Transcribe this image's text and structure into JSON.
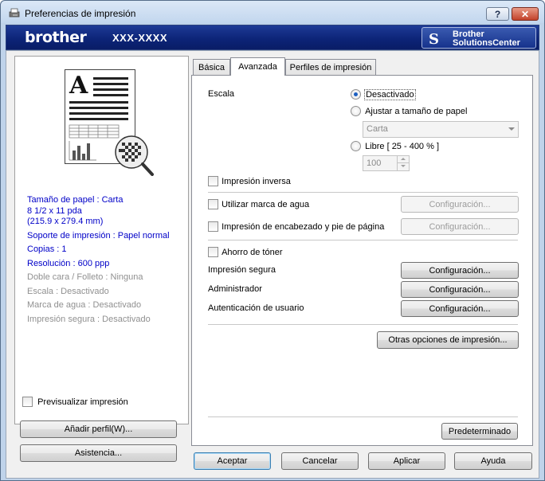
{
  "window": {
    "title": "Preferencias de impresión",
    "help_label": "?",
    "close_label": "✕"
  },
  "header": {
    "brand": "brother",
    "model": "XXX-XXXX",
    "solutions_line1": "Brother",
    "solutions_line2": "SolutionsCenter"
  },
  "summary": {
    "paper_size": "Tamaño de papel : Carta",
    "paper_dims_in": "8 1/2 x 11 pda",
    "paper_dims_mm": "(215.9 x 279.4 mm)",
    "media": "Soporte de impresión : Papel normal",
    "copies": "Copias : 1",
    "resolution": "Resolución : 600 ppp",
    "duplex": "Doble cara / Folleto : Ninguna",
    "scale": "Escala : Desactivado",
    "watermark": "Marca de agua : Desactivado",
    "secure_print": "Impresión segura : Desactivado"
  },
  "left": {
    "preview_label": "Previsualizar impresión",
    "preview_checked": false,
    "add_profile_label": "Añadir perfil(W)...",
    "support_label": "Asistencia..."
  },
  "tabs": [
    "Básica",
    "Avanzada",
    "Perfiles de impresión"
  ],
  "active_tab": "Avanzada",
  "advanced": {
    "scale_label": "Escala",
    "scale_off_label": "Desactivado",
    "fit_paper_label": "Ajustar a tamaño de papel",
    "paper_combo_value": "Carta",
    "free_label": "Libre [ 25 - 400 % ]",
    "free_value": "100",
    "scale_selected": "off",
    "reverse_print_label": "Impresión inversa",
    "watermark_label": "Utilizar marca de agua",
    "header_footer_label": "Impresión de encabezado y pie de página",
    "toner_save_label": "Ahorro de tóner",
    "secure_print_label": "Impresión segura",
    "admin_label": "Administrador",
    "user_auth_label": "Autenticación de usuario",
    "config_label": "Configuración...",
    "other_options_label": "Otras opciones de impresión...",
    "default_label": "Predeterminado"
  },
  "footer": {
    "ok_label": "Aceptar",
    "cancel_label": "Cancelar",
    "apply_label": "Aplicar",
    "help_label": "Ayuda"
  }
}
